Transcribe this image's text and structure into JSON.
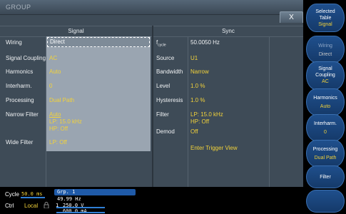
{
  "window": {
    "title": "GROUP",
    "close_label": "X"
  },
  "signal": {
    "header": "Signal",
    "rows": [
      {
        "label": "Wiring",
        "value": "Direct"
      },
      {
        "label": "Signal Coupling",
        "value": "AC"
      },
      {
        "label": "Harmonics",
        "value": "Auto"
      },
      {
        "label": "Interharm.",
        "value": "0"
      },
      {
        "label": "Processing",
        "value": "Dual Path"
      },
      {
        "label": "Narrow Filter",
        "value": "Auto",
        "value2": "LP: 15.0 kHz",
        "value3": "HP: Off"
      },
      {
        "label": "Wide Filter",
        "value": "LP: Off"
      }
    ]
  },
  "sync": {
    "header": "Sync",
    "rows": [
      {
        "label_main": "f",
        "label_sub": "cycle",
        "value": "50.0050 Hz"
      },
      {
        "label": "Source",
        "value": "U1"
      },
      {
        "label": "Bandwidth",
        "value": "Narrow"
      },
      {
        "label": "Level",
        "value": "1.0 %"
      },
      {
        "label": "Hysteresis",
        "value": "1.0 %"
      },
      {
        "label": "Filter",
        "value": "LP: 15.0 kHz",
        "value2": "HP: Off"
      },
      {
        "label": "Demod",
        "value": "Off"
      }
    ],
    "trigger_view": "Enter Trigger View"
  },
  "status": {
    "cycle_label": "Cycle",
    "cycle_value": "50.0 ms",
    "ctrl_label": "Ctrl",
    "ctrl_value": "Local",
    "group": "Grp. 1",
    "freq": "49.99  Hz",
    "voltage": "250.0 V",
    "current": "600.0 mA",
    "channel_marker": "1"
  },
  "softkeys": [
    {
      "line1": "Selected",
      "line2": "Table",
      "value": "Signal"
    },
    {
      "line1": "Wiring",
      "line2": "",
      "value": "Direct"
    },
    {
      "line1": "Signal",
      "line2": "Coupling",
      "value": "AC"
    },
    {
      "line1": "Harmonics",
      "line2": "",
      "value": "Auto"
    },
    {
      "line1": "Interharm.",
      "line2": "",
      "value": "0"
    },
    {
      "line1": "Processing",
      "line2": "",
      "value": "Dual Path"
    },
    {
      "line1": "Filter",
      "line2": "",
      "value": ""
    },
    {
      "line1": "",
      "line2": "",
      "value": ""
    }
  ],
  "colors": {
    "accent_value": "#f2d23a",
    "panel": "#3e4b57",
    "softkey": "#1f4f8c"
  }
}
